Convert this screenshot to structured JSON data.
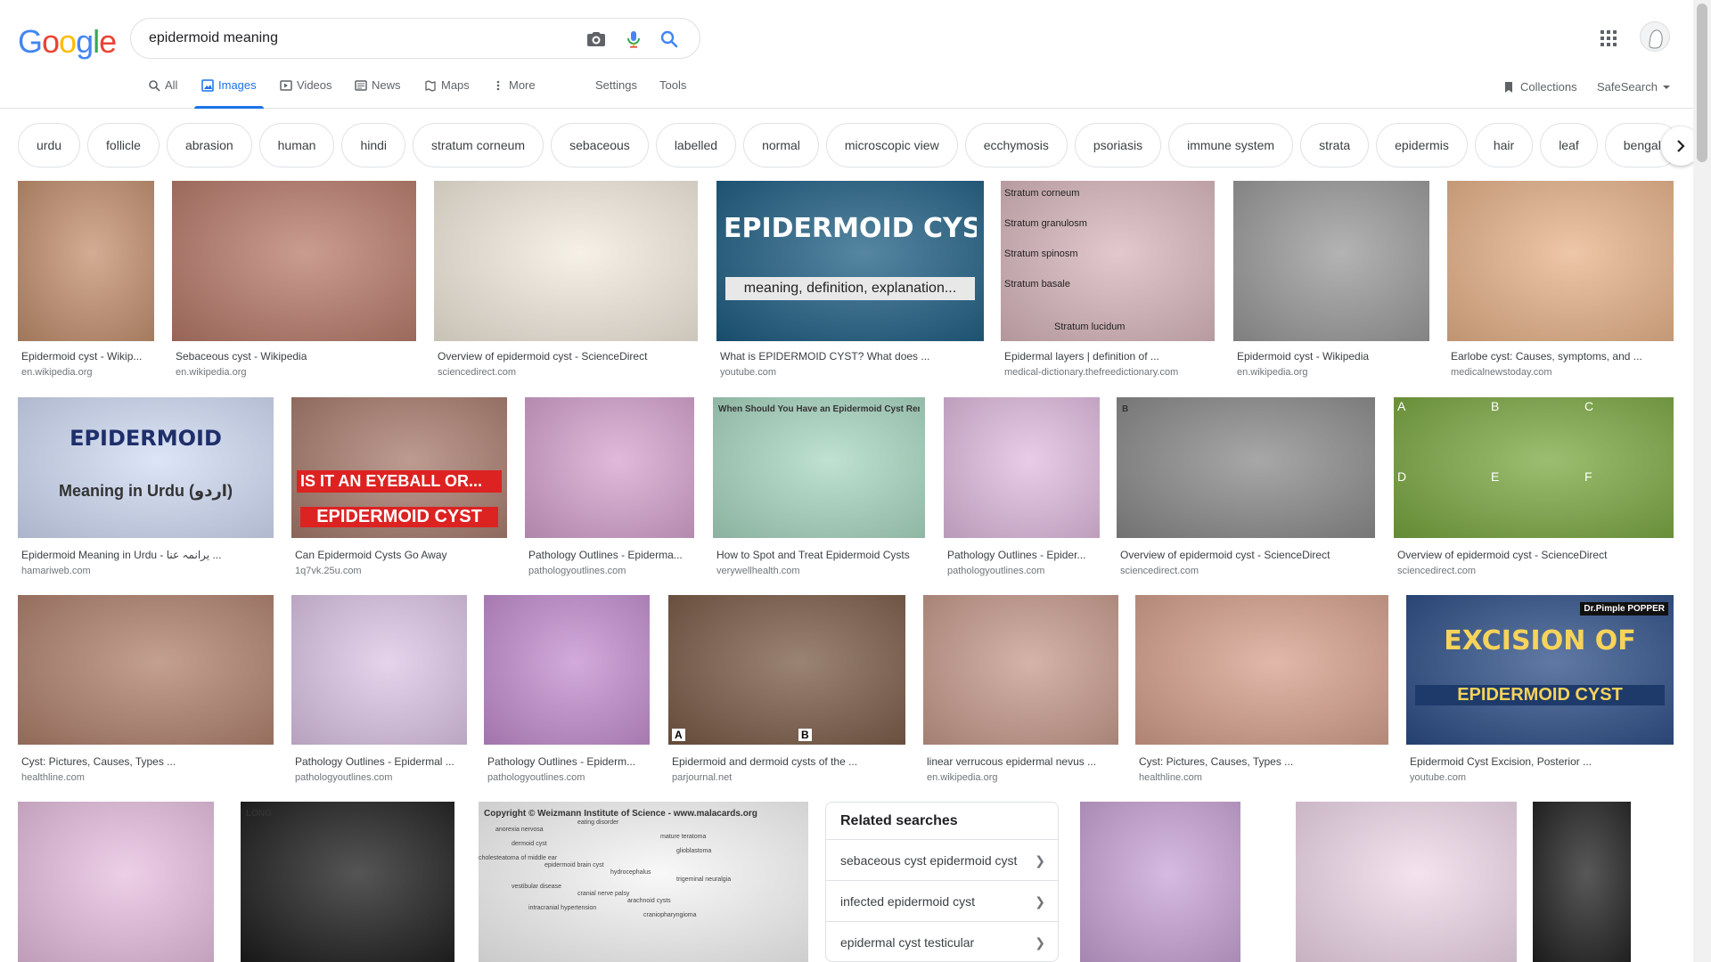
{
  "logo": "Google",
  "search": {
    "query": "epidermoid meaning",
    "placeholder": ""
  },
  "tabs": [
    {
      "label": "All",
      "icon": "search-icon"
    },
    {
      "label": "Images",
      "icon": "image-icon",
      "active": true
    },
    {
      "label": "Videos",
      "icon": "video-icon"
    },
    {
      "label": "News",
      "icon": "news-icon"
    },
    {
      "label": "Maps",
      "icon": "map-icon"
    },
    {
      "label": "More",
      "icon": "more-vert-icon"
    }
  ],
  "tools": {
    "settings": "Settings",
    "tools": "Tools",
    "collections": "Collections",
    "safesearch": "SafeSearch"
  },
  "chips": [
    "urdu",
    "follicle",
    "abrasion",
    "human",
    "hindi",
    "stratum corneum",
    "sebaceous",
    "labelled",
    "normal",
    "microscopic view",
    "ecchymosis",
    "psoriasis",
    "immune system",
    "strata",
    "epidermis",
    "hair",
    "leaf",
    "bengal"
  ],
  "rows": [
    [
      {
        "title": "Epidermoid cyst - Wikip...",
        "source": "en.wikipedia.org",
        "color": "#c4906e"
      },
      {
        "title": "Sebaceous cyst - Wikipedia",
        "source": "en.wikipedia.org",
        "color": "#b87a6a"
      },
      {
        "title": "Overview of epidermoid cyst - ScienceDirect",
        "source": "sciencedirect.com",
        "color": "#f3ecde"
      },
      {
        "title": "What is EPIDERMOID CYST? What does ...",
        "source": "youtube.com",
        "color": "#1c5d82",
        "overlay": "EPIDERMOID CYST",
        "overlay2": "meaning, definition, explanation..."
      },
      {
        "title": "Epidermal layers | definition of ...",
        "source": "medical-dictionary.thefreedictionary.com",
        "color": "#d9b7bd",
        "labels": [
          "Stratum corneum",
          "Stratum granulosm",
          "Stratum spinosm",
          "Stratum basale",
          "Stratum lucidum"
        ]
      },
      {
        "title": "Epidermoid cyst - Wikipedia",
        "source": "en.wikipedia.org",
        "color": "#9a9a9a"
      },
      {
        "title": "Earlobe cyst: Causes, symptoms, and ...",
        "source": "medicalnewstoday.com",
        "color": "#e8b48a"
      }
    ],
    [
      {
        "title": "Epidermoid Meaning in Urdu - یرانمہ عنا ...",
        "source": "hamariweb.com",
        "color": "#d1dcf5",
        "overlay": "EPIDERMOID",
        "overlay2": "Meaning in Urdu (اردو)"
      },
      {
        "title": "Can Epidermoid Cysts Go Away",
        "source": "1q7vk.25u.com",
        "color": "#a87a6c",
        "overlay": "IS IT AN EYEBALL OR...",
        "overlay2": "EPIDERMOID CYST"
      },
      {
        "title": "Pathology Outlines - Epiderma...",
        "source": "pathologyoutlines.com",
        "color": "#d6a3cf"
      },
      {
        "title": "How to Spot and Treat Epidermoid Cysts",
        "source": "verywellhealth.com",
        "color": "#a9d8c2",
        "overlay": "When Should You Have an Epidermoid Cyst Removed?"
      },
      {
        "title": "Pathology Outlines - Epider...",
        "source": "pathologyoutlines.com",
        "color": "#e1bce0"
      },
      {
        "title": "Overview of epidermoid cyst - ScienceDirect",
        "source": "sciencedirect.com",
        "color": "#8a8a8a",
        "overlay": "B"
      },
      {
        "title": "Overview of epidermoid cyst - ScienceDirect",
        "source": "sciencedirect.com",
        "color": "#7aa840",
        "labels": [
          "A",
          "B",
          "C",
          "D",
          "E",
          "F"
        ]
      }
    ],
    [
      {
        "title": "Cyst: Pictures, Causes, Types ...",
        "source": "healthline.com",
        "color": "#b0806c"
      },
      {
        "title": "Pathology Outlines - Epidermal ...",
        "source": "pathologyoutlines.com",
        "color": "#ddc5e6"
      },
      {
        "title": "Pathology Outlines - Epiderm...",
        "source": "pathologyoutlines.com",
        "color": "#c48ed0"
      },
      {
        "title": "Epidermoid and dermoid cysts of the ...",
        "source": "parjournal.net",
        "color": "#7a5a45",
        "labels": [
          "A",
          "B"
        ]
      },
      {
        "title": "linear verrucous epidermal nevus ...",
        "source": "en.wikipedia.org",
        "color": "#c79a8c"
      },
      {
        "title": "Cyst: Pictures, Causes, Types ...",
        "source": "healthline.com",
        "color": "#d6a08c"
      },
      {
        "title": "Epidermoid Cyst Excision, Posterior ...",
        "source": "youtube.com",
        "color": "#2b4d86",
        "overlay": "EXCISION OF",
        "overlay2": "EPIDERMOID CYST",
        "overlay3": "Dr.Pimple POPPER"
      }
    ],
    [
      {
        "title": "",
        "source": "",
        "color": "#e8bfe0"
      },
      {
        "title": "",
        "source": "",
        "color": "#1c1c1c",
        "overlay": "LONG"
      },
      {
        "title": "",
        "source": "",
        "color": "#f6f6f6",
        "labels": [
          "eating disorder",
          "anorexia nervosa",
          "mature teratoma",
          "dermoid cyst",
          "glioblastoma",
          "cholesteatoma of middle ear",
          "epidermoid brain cyst",
          "hydrocephalus",
          "trigeminal neuralgia",
          "vestibular disease",
          "cranial nerve palsy",
          "arachnoid cysts",
          "intracranial hypertension",
          "craniopharyngioma"
        ],
        "overlay": "Copyright © Weizmann Institute of Science - www.malacards.org"
      },
      {
        "title": "",
        "source": "",
        "color": "#c9a3d6"
      },
      {
        "title": "",
        "source": "",
        "color": "#f1d9ea"
      },
      {
        "title": "",
        "source": "",
        "color": "#202020"
      }
    ]
  ],
  "related": {
    "title": "Related searches",
    "items": [
      "sebaceous cyst epidermoid cyst",
      "infected epidermoid cyst",
      "epidermal cyst testicular"
    ]
  },
  "colors": {
    "blue": "#4285f4",
    "red": "#ea4335",
    "yellow": "#fbbc05",
    "green": "#34a853",
    "accent": "#1a73e8"
  }
}
